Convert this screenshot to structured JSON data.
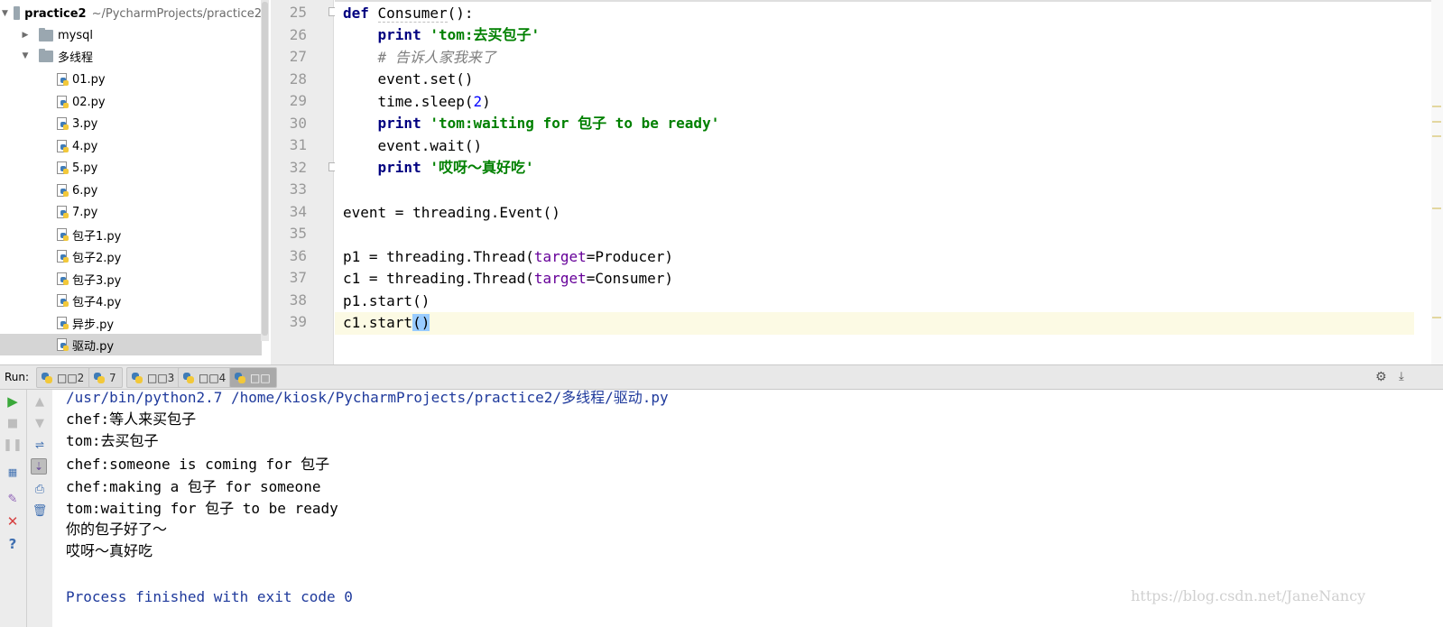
{
  "project_tree": {
    "root": {
      "name": "practice2",
      "path": "~/PycharmProjects/practice2"
    },
    "folders": [
      "mysql",
      "多线程"
    ],
    "files": [
      "01.py",
      "02.py",
      "3.py",
      "4.py",
      "5.py",
      "6.py",
      "7.py",
      "包子1.py",
      "包子2.py",
      "包子3.py",
      "包子4.py",
      "异步.py",
      "驱动.py"
    ],
    "selected_file": "驱动.py"
  },
  "editor": {
    "line_numbers": [
      "25",
      "26",
      "27",
      "28",
      "29",
      "30",
      "31",
      "32",
      "33",
      "34",
      "35",
      "36",
      "37",
      "38",
      "39"
    ],
    "current_line": "39",
    "code": {
      "l25": {
        "kw": "def",
        "name": "Consumer",
        "rest": "():"
      },
      "l26": {
        "indent": "    ",
        "kw": "print",
        "str": "'tom:去买包子'"
      },
      "l27": {
        "indent": "    ",
        "comment": "# 告诉人家我来了"
      },
      "l28": {
        "indent": "    ",
        "text": "event.set()"
      },
      "l29": {
        "indent": "    ",
        "pre": "time.sleep(",
        "num": "2",
        "post": ")"
      },
      "l30": {
        "indent": "    ",
        "kw": "print",
        "str": "'tom:waiting for 包子 to be ready'"
      },
      "l31": {
        "indent": "    ",
        "text": "event.wait()"
      },
      "l32": {
        "indent": "    ",
        "kw": "print",
        "str": "'哎呀～真好吃'"
      },
      "l34": {
        "text": "event = threading.Event()"
      },
      "l36": {
        "pre": "p1 = threading.Thread(",
        "param": "target",
        "post": "=Producer)"
      },
      "l37": {
        "pre": "c1 = threading.Thread(",
        "param": "target",
        "post": "=Consumer)"
      },
      "l38": {
        "text": "p1.start()"
      },
      "l39": {
        "pre": "c1.start",
        "brace": "()"
      }
    }
  },
  "run_panel": {
    "label": "Run:",
    "tabs": [
      {
        "label": "□□2",
        "active": false
      },
      {
        "label": "7",
        "active": false
      },
      {
        "label": "□□3",
        "active": false
      },
      {
        "label": "□□4",
        "active": false
      },
      {
        "label": "□□",
        "active": true
      }
    ],
    "console": [
      "/usr/bin/python2.7 /home/kiosk/PycharmProjects/practice2/多线程/驱动.py",
      "chef:等人来买包子",
      "tom:去买包子",
      "chef:someone is coming for 包子",
      "chef:making a 包子 for someone",
      "tom:waiting for 包子 to be ready",
      "你的包子好了～",
      "哎呀～真好吃",
      "Process finished with exit code 0"
    ],
    "watermark": "https://blog.csdn.net/JaneNancy"
  },
  "icons": {
    "run": "run-icon",
    "stop": "stop-icon",
    "pause": "pause-icon",
    "rerun": "rerun-icon",
    "up": "up-arrow-icon",
    "down": "down-arrow-icon",
    "wrap": "soft-wrap-icon",
    "scroll": "scroll-to-end-icon",
    "print": "print-icon",
    "trash": "clear-all-icon",
    "pin": "pin-icon",
    "close": "close-icon",
    "help": "help-icon",
    "settings": "gear-icon",
    "hide": "hide-panel-icon"
  },
  "colors": {
    "keyword": "#000080",
    "string": "#008000",
    "comment": "#808080",
    "number": "#0000ff",
    "param": "#660099",
    "console_system": "#1f3a9c",
    "current_line": "#fcfae4",
    "selected_tree_row": "#d5d5d5"
  }
}
